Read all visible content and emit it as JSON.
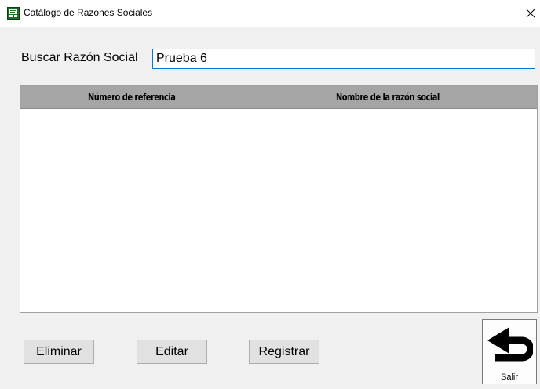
{
  "window": {
    "title": "Catálogo de Razones Sociales",
    "icon": "app-catalog-icon",
    "close_icon": "close-icon"
  },
  "search": {
    "label": "Buscar Razón Social",
    "value": "Prueba 6"
  },
  "grid": {
    "columns": [
      "Número de referencia",
      "Nombre de la razón social"
    ],
    "rows": []
  },
  "buttons": {
    "delete_label": "Eliminar",
    "edit_label": "Editar",
    "register_label": "Registrar",
    "exit_label": "Salir",
    "exit_icon": "return-arrow-icon"
  },
  "colors": {
    "header_bg": "#a5a5a5",
    "input_focus_border": "#0078d7",
    "window_bg": "#f0f0f0"
  }
}
